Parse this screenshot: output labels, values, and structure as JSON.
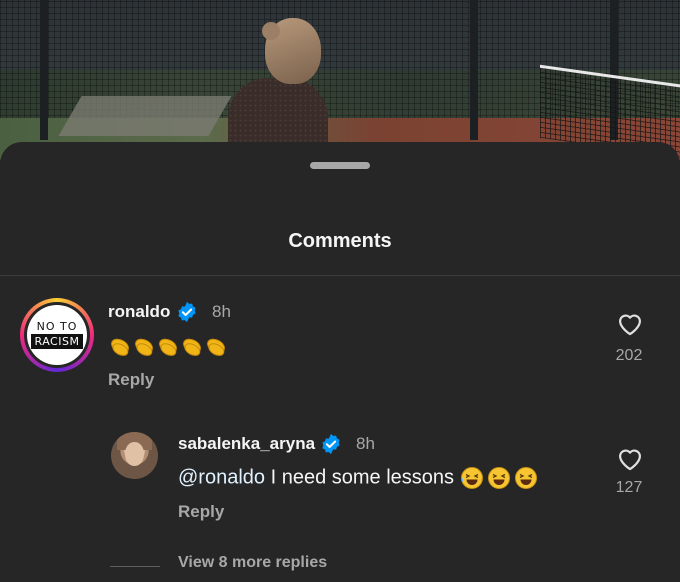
{
  "sheet": {
    "title": "Comments"
  },
  "comments": [
    {
      "username": "ronaldo",
      "time": "8h",
      "text_emoji": "👏👏👏👏👏",
      "reply_label": "Reply",
      "likes": "202",
      "avatar_text_top": "NO TO",
      "avatar_text_bottom": "RACISM"
    },
    {
      "username": "sabalenka_aryna",
      "time": "8h",
      "mention": "@ronaldo",
      "text": " I need some lessons ",
      "reply_label": "Reply",
      "likes": "127"
    }
  ],
  "view_more": "View 8 more replies",
  "icons": {
    "verified": "verified-badge-icon",
    "like": "heart-icon",
    "clap": "clapping-hands-icon",
    "laugh": "laughing-face-icon"
  },
  "colors": {
    "background": "#262626",
    "verified": "#0095f6",
    "secondary_text": "#a8a8a8"
  }
}
